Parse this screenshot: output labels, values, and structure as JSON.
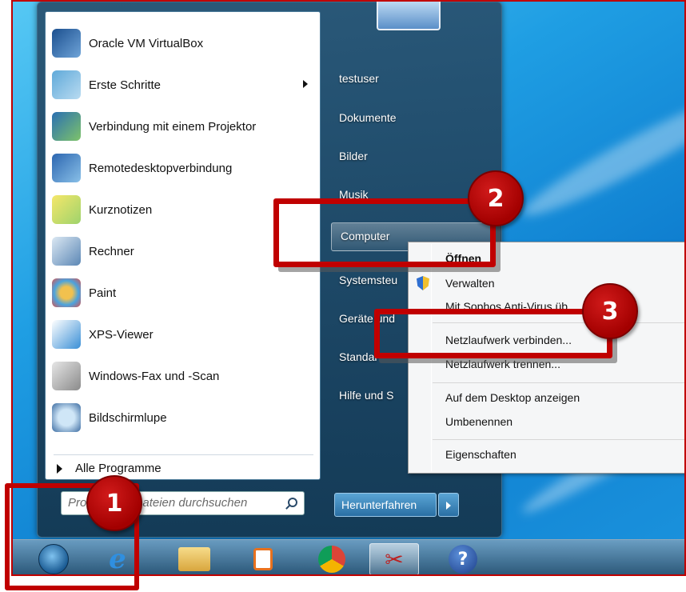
{
  "start_menu": {
    "programs": [
      {
        "label": "Oracle VM VirtualBox",
        "icon": "virtualbox-icon"
      },
      {
        "label": "Erste Schritte",
        "icon": "getting-started-icon",
        "has_submenu": true
      },
      {
        "label": "Verbindung mit einem Projektor",
        "icon": "projector-icon"
      },
      {
        "label": "Remotedesktopverbindung",
        "icon": "remote-desktop-icon"
      },
      {
        "label": "Kurznotizen",
        "icon": "sticky-notes-icon"
      },
      {
        "label": "Rechner",
        "icon": "calculator-icon"
      },
      {
        "label": "Paint",
        "icon": "paint-icon"
      },
      {
        "label": "XPS-Viewer",
        "icon": "xps-viewer-icon"
      },
      {
        "label": "Windows-Fax und -Scan",
        "icon": "fax-scan-icon"
      },
      {
        "label": "Bildschirmlupe",
        "icon": "magnifier-icon"
      }
    ],
    "all_programs": "Alle Programme",
    "search_placeholder": "Programme/Dateien durchsuchen",
    "right_links": [
      "testuser",
      "Dokumente",
      "Bilder",
      "Musik",
      "Computer",
      "Systemsteu",
      "Geräte und",
      "Standar",
      "Hilfe und S"
    ],
    "shutdown": "Herunterfahren"
  },
  "context_menu": {
    "items": [
      "Öffnen",
      "Verwalten",
      "Mit Sophos Anti-Virus üb",
      "Netzlaufwerk verbinden...",
      "Netzlaufwerk trennen...",
      "Auf dem Desktop anzeigen",
      "Umbenennen",
      "Eigenschaften"
    ]
  },
  "taskbar": {
    "items": [
      "start-orb-icon",
      "internet-explorer-icon",
      "explorer-icon",
      "media-player-icon",
      "chrome-icon",
      "snipping-tool-icon",
      "help-icon"
    ]
  },
  "annotations": {
    "badge1": "1",
    "badge2": "2",
    "badge3": "3"
  },
  "colors": {
    "highlight": "#c00000",
    "desktop": "#1f9ee3"
  }
}
